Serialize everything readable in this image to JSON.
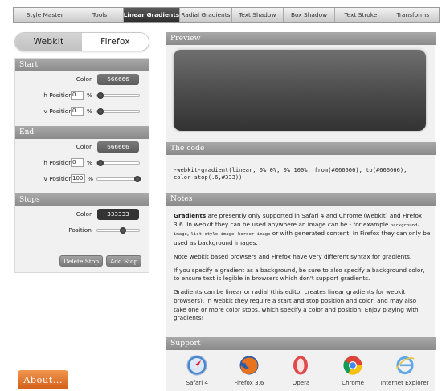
{
  "nav": {
    "items": [
      "Style Master",
      "Tools",
      "Linear Gradients",
      "Radial Gradients",
      "Text Shadow",
      "Box Shadow",
      "Text Stroke",
      "Transforms"
    ],
    "active_index": 2
  },
  "browser_toggle": {
    "webkit": "Webkit",
    "firefox": "Firefox",
    "active": "Webkit"
  },
  "start": {
    "title": "Start",
    "color_label": "Color",
    "color_value": "666666",
    "h_label": "h Position",
    "h_value": "0",
    "v_label": "v Position",
    "v_value": "0",
    "unit": "%",
    "h_fraction": 0.0,
    "v_fraction": 0.0
  },
  "end": {
    "title": "End",
    "color_label": "Color",
    "color_value": "666666",
    "h_label": "h Position",
    "h_value": "0",
    "v_label": "v Position",
    "v_value": "100",
    "unit": "%",
    "h_fraction": 0.0,
    "v_fraction": 1.0
  },
  "stops": {
    "title": "Stops",
    "color_label": "Color",
    "color_value": "333333",
    "position_label": "Position",
    "position_fraction": 0.6,
    "delete_label": "Delete Stop",
    "add_label": "Add Stop"
  },
  "about_label": "About...",
  "preview": {
    "title": "Preview"
  },
  "code": {
    "title": "The code",
    "text": "-webkit-gradient(linear, 0% 0%, 0% 100%, from(#666666), to(#666666),\ncolor-stop(.6,#333))"
  },
  "notes": {
    "title": "Notes",
    "p1_bold": "Gradients",
    "p1_a": " are presently only supported in Safari 4 and Chrome (webkit) and Firefox 3.6. In webkit they can be used anywhere an image can be - for example ",
    "p1_code1": "background-image",
    "p1_sep1": ", ",
    "p1_code2": "list-style-image",
    "p1_sep2": ", ",
    "p1_code3": "border-image",
    "p1_b": " or with generated content. In Firefox they can only be used as background images.",
    "p2": "Note webkit based browsers and Firefox have very different syntax for gradients.",
    "p3": "If you specify a gradient as a background, be sure to also specify a background color, to ensure text is legible in browsers which don't support gradients.",
    "p4": "Gradients can be linear or radial (this editor creates linear gradients for webkit browsers). In webkit they require a start and stop position and color, and may also take one or more color stops, which specify a color and position. Enjoy playing with gradients!"
  },
  "support": {
    "title": "Support",
    "browsers": [
      {
        "name": "Safari 4",
        "icon": "safari-icon"
      },
      {
        "name": "Firefox 3.6",
        "icon": "firefox-icon"
      },
      {
        "name": "Opera",
        "icon": "opera-icon"
      },
      {
        "name": "Chrome",
        "icon": "chrome-icon"
      },
      {
        "name": "Internet Explorer",
        "icon": "internet-explorer-icon"
      }
    ]
  },
  "colors": {
    "accent_orange": "#e2712a",
    "header_gray": "#999999",
    "preview_dark": "#333333"
  }
}
